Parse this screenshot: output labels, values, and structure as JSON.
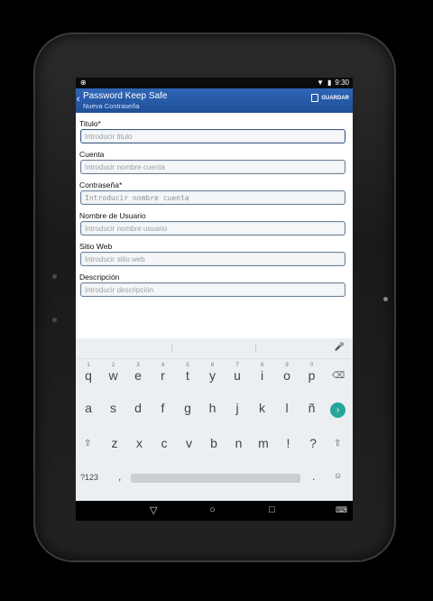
{
  "status": {
    "left_icon": "android-icon",
    "time": "9:30"
  },
  "appbar": {
    "title": "Password Keep Safe",
    "subtitle": "Nueva Contraseña",
    "save_label": "GUARDAR"
  },
  "form": {
    "fields": [
      {
        "label": "Titulo*",
        "placeholder": "Introducir titulo"
      },
      {
        "label": "Cuenta",
        "placeholder": "Introducir nombre cuenta"
      },
      {
        "label": "Contraseña*",
        "placeholder": "Introducir nombre cuenta"
      },
      {
        "label": "Nombre de Usuario",
        "placeholder": "Introducir nombre usuario"
      },
      {
        "label": "Sitio Web",
        "placeholder": "Introducir sitio web"
      },
      {
        "label": "Descripción",
        "placeholder": "Introducir descripción"
      }
    ]
  },
  "keyboard": {
    "row1_hints": [
      "1",
      "2",
      "3",
      "4",
      "5",
      "6",
      "7",
      "8",
      "9",
      "0"
    ],
    "row1": [
      "q",
      "w",
      "e",
      "r",
      "t",
      "y",
      "u",
      "i",
      "o",
      "p"
    ],
    "row2": [
      "a",
      "s",
      "d",
      "f",
      "g",
      "h",
      "j",
      "k",
      "l",
      "ñ"
    ],
    "row3": [
      "z",
      "x",
      "c",
      "v",
      "b",
      "n",
      "m",
      "!",
      "?"
    ],
    "num_key": "?123",
    "comma": ",",
    "period": "."
  }
}
